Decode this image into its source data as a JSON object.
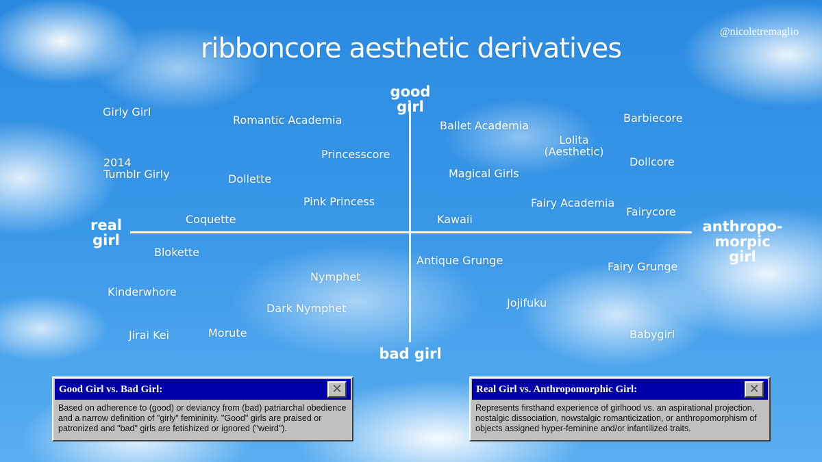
{
  "title": "ribboncore aesthetic derivatives",
  "handle": "@nicoletremaglio",
  "axes": {
    "top": "good girl",
    "bottom": "bad girl",
    "left": "real\ngirl",
    "right": "anthropo-\nmorpic girl"
  },
  "terms": {
    "girly_girl": "Girly Girl",
    "romantic_academia": "Romantic Academia",
    "tumblr_girly": "2014\nTumblr Girly",
    "princesscore": "Princesscore",
    "dollette": "Dollette",
    "pink_princess": "Pink Princess",
    "coquette": "Coquette",
    "ballet_academia": "Ballet Academia",
    "lolita": "Lolita\n(Aesthetic)",
    "barbiecore": "Barbiecore",
    "dollcore": "Dollcore",
    "magical_girls": "Magical Girls",
    "fairy_academia": "Fairy Academia",
    "fairycore": "Fairycore",
    "kawaii": "Kawaii",
    "blokette": "Blokette",
    "kinderwhore": "Kinderwhore",
    "nymphet": "Nymphet",
    "dark_nymphet": "Dark Nymphet",
    "jirai_kei": "Jirai Kei",
    "morute": "Morute",
    "antique_grunge": "Antique Grunge",
    "fairy_grunge": "Fairy Grunge",
    "jojifuku": "Jojifuku",
    "babygirl": "Babygirl"
  },
  "dialogs": {
    "good_bad": {
      "title": "Good Girl vs. Bad Girl:",
      "close_glyph": "✕",
      "text": "Based on adherence to (good) or deviancy from (bad) patriarchal obedience and a narrow definition of \"girly\" femininity. \"Good\" girls are praised or patronized and \"bad\" girls are fetishized or ignored (\"weird\")."
    },
    "real_anthro": {
      "title": "Real Girl vs. Anthropomorphic Girl:",
      "close_glyph": "✕",
      "text": "Represents firsthand experience of girlhood vs. an aspirational projection, nostalgic dissociation, nowstalgic romanticization, or anthropomorphism of objects assigned hyper-feminine and/or infantilized traits."
    }
  },
  "colors": {
    "sky": "#2f8fe0",
    "text": "#ffffff",
    "dialog_titlebar": "#0000a8",
    "dialog_face": "#c0c0c0"
  },
  "icons": {
    "close": "close-icon"
  }
}
